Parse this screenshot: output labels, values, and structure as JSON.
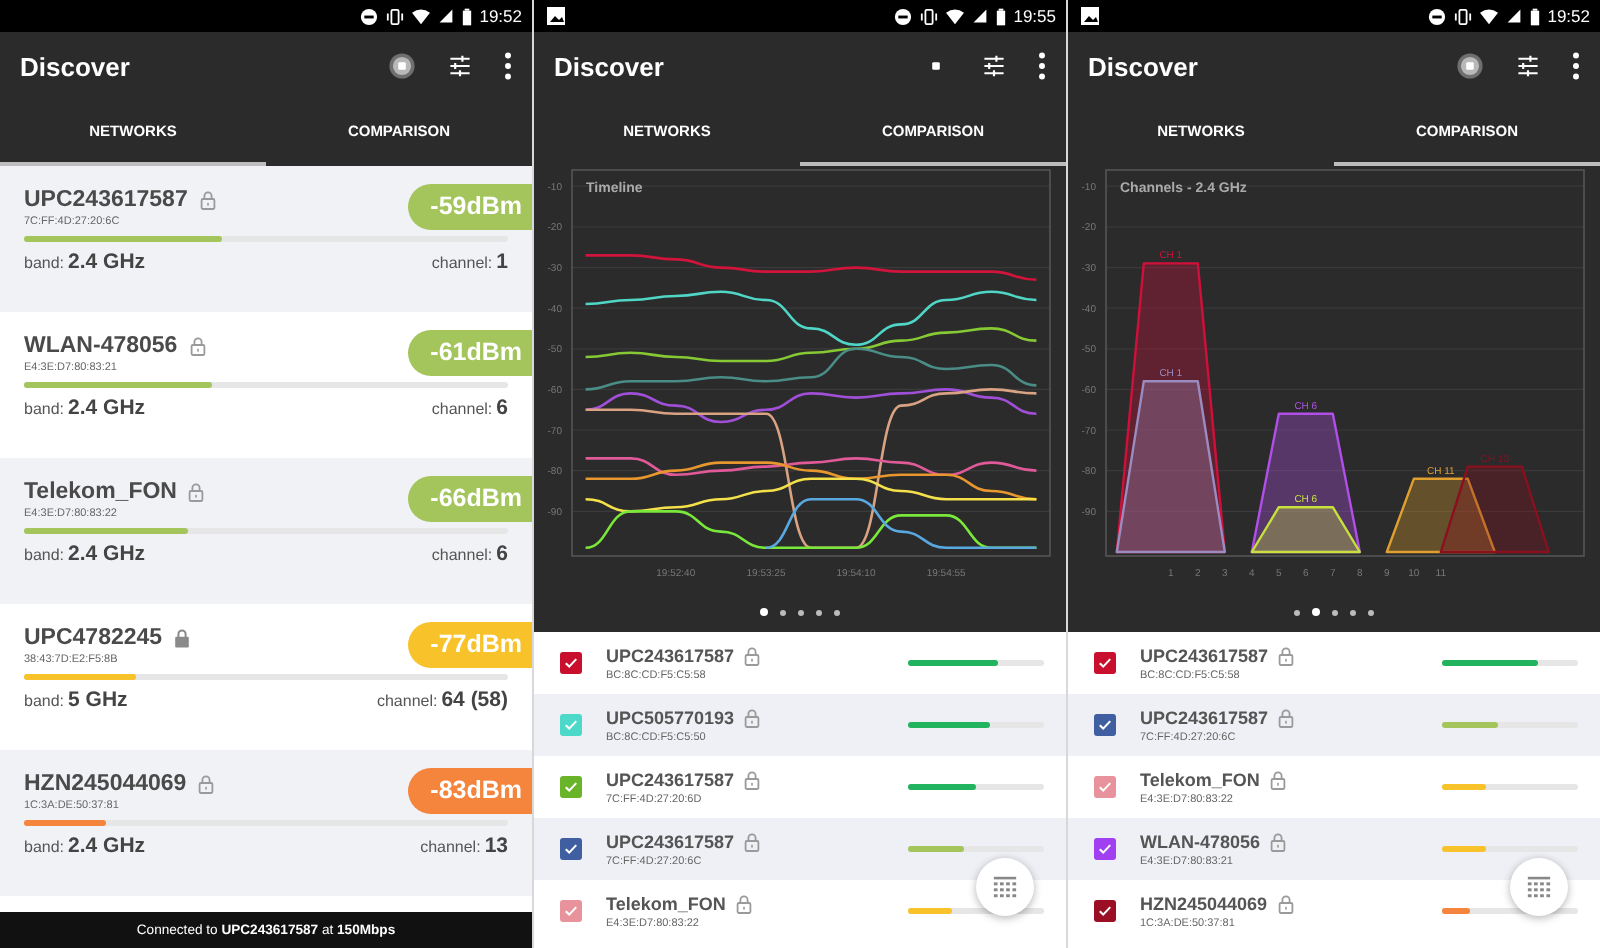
{
  "screens": [
    {
      "kind": "networks",
      "status_bar": {
        "time": "19:52",
        "image_notification": false
      },
      "app_bar": {
        "title": "Discover",
        "scanning": true
      },
      "tabs": [
        {
          "label": "NETWORKS",
          "selected": true
        },
        {
          "label": "COMPARISON",
          "selected": false
        }
      ],
      "networks": [
        {
          "name": "UPC243617587",
          "solid_lock": false,
          "mac": "7C:FF:4D:27:20:6C",
          "signal": "-59dBm",
          "level": 0.41,
          "band_label": "band:",
          "band": "2.4 GHz",
          "channel_label": "channel:",
          "channel": "1"
        },
        {
          "name": "WLAN-478056",
          "solid_lock": false,
          "mac": "E4:3E:D7:80:83:21",
          "signal": "-61dBm",
          "level": 0.39,
          "band_label": "band:",
          "band": "2.4 GHz",
          "channel_label": "channel:",
          "channel": "6"
        },
        {
          "name": "Telekom_FON",
          "solid_lock": false,
          "mac": "E4:3E:D7:80:83:22",
          "signal": "-66dBm",
          "level": 0.34,
          "band_label": "band:",
          "band": "2.4 GHz",
          "channel_label": "channel:",
          "channel": "6"
        },
        {
          "name": "UPC4782245",
          "solid_lock": true,
          "mac": "38:43:7D:E2:F5:8B",
          "signal": "-77dBm",
          "level": 0.23,
          "band_label": "band:",
          "band": "5 GHz",
          "channel_label": "channel:",
          "channel": "64 (58)"
        },
        {
          "name": "HZN245044069",
          "solid_lock": false,
          "mac": "1C:3A:DE:50:37:81",
          "signal": "-83dBm",
          "level": 0.17,
          "band_label": "band:",
          "band": "2.4 GHz",
          "channel_label": "channel:",
          "channel": "13"
        }
      ],
      "footer": "Connected to **UPC243617587** at **150Mbps**"
    },
    {
      "kind": "comparison",
      "status_bar": {
        "time": "19:55",
        "image_notification": true
      },
      "app_bar": {
        "title": "Discover",
        "scanning": false
      },
      "tabs": [
        {
          "label": "NETWORKS",
          "selected": false
        },
        {
          "label": "COMPARISON",
          "selected": true
        }
      ],
      "chart_data": {
        "type": "line",
        "title": "Timeline",
        "grid": true,
        "categories": [
          null,
          null,
          "19:52:40",
          null,
          "19:53:25",
          null,
          "19:54:10",
          null,
          "19:54:55",
          null,
          null
        ],
        "ylim": [
          -101,
          -6
        ],
        "yticks": [
          -10,
          -20,
          -30,
          -40,
          -50,
          -60,
          -70,
          -80,
          -90
        ],
        "series": [
          {
            "color": "#d0143c",
            "values": [
              -27,
              -27,
              -28,
              -30,
              -31,
              -31,
              -30,
              -31,
              -31,
              -31,
              -33
            ]
          },
          {
            "color": "#4fd6c6",
            "values": [
              -39,
              -38,
              -37,
              -36,
              -38,
              -45,
              -49,
              -44,
              -38,
              -36,
              -38
            ]
          },
          {
            "color": "#86c934",
            "values": [
              -52,
              -51,
              -52,
              -53,
              -53,
              -51,
              -50,
              -48,
              -46,
              -45,
              -48
            ]
          },
          {
            "color": "#4a8c86",
            "values": [
              -60,
              -58,
              -58,
              -57,
              -58,
              -57,
              -50,
              -52,
              -55,
              -54,
              -59
            ]
          },
          {
            "color": "#a04fd8",
            "values": [
              -65,
              -61,
              -64,
              -68,
              -65,
              -61,
              -62,
              -61,
              -60,
              -62,
              -66
            ]
          },
          {
            "color": "#d9a383",
            "values": [
              -65,
              -65,
              -66,
              -66,
              -66,
              -99,
              -99,
              -64,
              -61,
              -60,
              -61
            ]
          },
          {
            "color": "#e05a9a",
            "values": [
              -77,
              -77,
              -81,
              -80,
              -79,
              -78,
              -77,
              -78,
              -81,
              -78,
              -80
            ]
          },
          {
            "color": "#e8962e",
            "values": [
              -82,
              -82,
              -80,
              -78,
              -78,
              -80,
              -82,
              -81,
              -81,
              -85,
              -87
            ]
          },
          {
            "color": "#f3e04a",
            "values": [
              -87,
              -90,
              -89,
              -87,
              -85,
              -82,
              -82,
              -85,
              -87,
              -87,
              -87
            ]
          },
          {
            "color": "#7ae83a",
            "values": [
              -99,
              -90,
              -90,
              -95,
              -99,
              -99,
              -99,
              -91,
              -91,
              -99,
              -99
            ]
          },
          {
            "color": "#5aa8e0",
            "values": [
              null,
              null,
              null,
              null,
              -99,
              -87,
              -87,
              -95,
              -99,
              -99,
              -99
            ]
          }
        ]
      },
      "pager": [
        {
          "selected": true
        },
        {
          "selected": false
        },
        {
          "selected": false
        },
        {
          "selected": false
        },
        {
          "selected": false
        }
      ],
      "rows": [
        {
          "color": "#c8102e",
          "checked": true,
          "name": "UPC243617587",
          "mac": "BC:8C:CD:F5:C5:58",
          "level": 0.66
        },
        {
          "color": "#4dd9c9",
          "checked": true,
          "name": "UPC505770193",
          "mac": "BC:8C:CD:F5:C5:50",
          "level": 0.61
        },
        {
          "color": "#6ab42a",
          "checked": true,
          "name": "UPC243617587",
          "mac": "7C:FF:4D:27:20:6D",
          "level": 0.5
        },
        {
          "color": "#3f5fa0",
          "checked": true,
          "name": "UPC243617587",
          "mac": "7C:FF:4D:27:20:6C",
          "level": 0.41
        },
        {
          "color": "#e8929c",
          "checked": true,
          "name": "Telekom_FON",
          "mac": "E4:3E:D7:80:83:22",
          "level": 0.33
        }
      ]
    },
    {
      "kind": "comparison",
      "status_bar": {
        "time": "19:52",
        "image_notification": true
      },
      "app_bar": {
        "title": "Discover",
        "scanning": true
      },
      "tabs": [
        {
          "label": "NETWORKS",
          "selected": false
        },
        {
          "label": "COMPARISON",
          "selected": true
        }
      ],
      "chart_data": {
        "type": "area",
        "title": "Channels - 2.4 GHz",
        "grid": true,
        "x": [
          -1,
          0,
          1,
          2,
          3,
          4,
          5,
          6,
          7,
          8,
          9,
          10,
          11,
          12,
          13,
          14,
          15
        ],
        "xlim": [
          -1.4,
          16.3
        ],
        "ylim": [
          -101,
          -6
        ],
        "xticks": [
          1,
          2,
          3,
          4,
          5,
          6,
          7,
          8,
          9,
          10,
          11
        ],
        "yticks": [
          -10,
          -20,
          -30,
          -40,
          -50,
          -60,
          -70,
          -80,
          -90
        ],
        "series": [
          {
            "name": "CH 1",
            "color": "#d0103a",
            "values": [
              -100,
              -29,
              -29,
              -29,
              -100,
              null,
              null,
              null,
              null,
              null,
              null,
              null,
              null,
              null,
              null,
              null,
              null
            ]
          },
          {
            "name": "CH 1",
            "color": "#9a8cc0",
            "values": [
              -100,
              -58,
              -58,
              -58,
              -100,
              null,
              null,
              null,
              null,
              null,
              null,
              null,
              null,
              null,
              null,
              null,
              null
            ]
          },
          {
            "name": "CH 6",
            "color": "#b050e8",
            "values": [
              null,
              null,
              null,
              null,
              null,
              -100,
              -66,
              -66,
              -66,
              -100,
              null,
              null,
              null,
              null,
              null,
              null,
              null
            ]
          },
          {
            "name": "CH 6",
            "color": "#c8e03c",
            "values": [
              null,
              null,
              null,
              null,
              null,
              -100,
              -89,
              -89,
              -89,
              -100,
              null,
              null,
              null,
              null,
              null,
              null,
              null
            ]
          },
          {
            "name": "CH 11",
            "color": "#e0a030",
            "values": [
              null,
              null,
              null,
              null,
              null,
              null,
              null,
              null,
              null,
              null,
              -100,
              -82,
              -82,
              -82,
              -100,
              null,
              null
            ]
          },
          {
            "name": "CH 13",
            "color": "#8a1020",
            "values": [
              null,
              null,
              null,
              null,
              null,
              null,
              null,
              null,
              null,
              null,
              null,
              null,
              -100,
              -79,
              -79,
              -79,
              -100
            ]
          }
        ]
      },
      "pager": [
        {
          "selected": false
        },
        {
          "selected": true
        },
        {
          "selected": false
        },
        {
          "selected": false
        },
        {
          "selected": false
        }
      ],
      "rows": [
        {
          "color": "#c8102e",
          "checked": true,
          "name": "UPC243617587",
          "mac": "BC:8C:CD:F5:C5:58",
          "level": 0.7
        },
        {
          "color": "#3f5fa0",
          "checked": true,
          "name": "UPC243617587",
          "mac": "7C:FF:4D:27:20:6C",
          "level": 0.41
        },
        {
          "color": "#e8929c",
          "checked": true,
          "name": "Telekom_FON",
          "mac": "E4:3E:D7:80:83:22",
          "level": 0.33
        },
        {
          "color": "#a040f0",
          "checked": true,
          "name": "WLAN-478056",
          "mac": "E4:3E:D7:80:83:21",
          "level": 0.33
        },
        {
          "color": "#9a0f24",
          "checked": true,
          "name": "HZN245044069",
          "mac": "1C:3A:DE:50:37:81",
          "level": 0.2
        }
      ]
    }
  ]
}
